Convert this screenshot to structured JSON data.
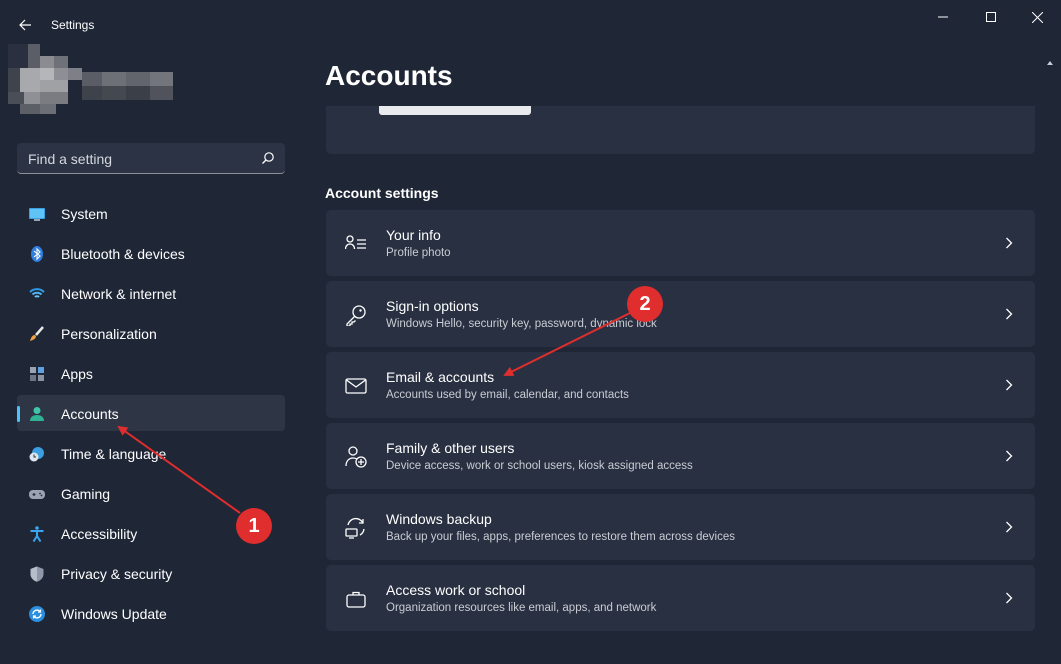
{
  "app": {
    "title": "Settings",
    "page_title": "Accounts"
  },
  "search": {
    "placeholder": "Find a setting"
  },
  "sidebar": {
    "items": [
      {
        "label": "System",
        "icon": "monitor-icon"
      },
      {
        "label": "Bluetooth & devices",
        "icon": "bluetooth-icon"
      },
      {
        "label": "Network & internet",
        "icon": "wifi-icon"
      },
      {
        "label": "Personalization",
        "icon": "brush-icon"
      },
      {
        "label": "Apps",
        "icon": "apps-icon"
      },
      {
        "label": "Accounts",
        "icon": "person-icon",
        "active": true
      },
      {
        "label": "Time & language",
        "icon": "clock-globe-icon"
      },
      {
        "label": "Gaming",
        "icon": "gamepad-icon"
      },
      {
        "label": "Accessibility",
        "icon": "accessibility-icon"
      },
      {
        "label": "Privacy & security",
        "icon": "shield-icon"
      },
      {
        "label": "Windows Update",
        "icon": "update-icon"
      }
    ]
  },
  "main": {
    "section_label": "Account settings",
    "cards": [
      {
        "title": "Your info",
        "subtitle": "Profile photo",
        "icon": "person-card-icon"
      },
      {
        "title": "Sign-in options",
        "subtitle": "Windows Hello, security key, password, dynamic lock",
        "icon": "key-icon"
      },
      {
        "title": "Email & accounts",
        "subtitle": "Accounts used by email, calendar, and contacts",
        "icon": "mail-icon"
      },
      {
        "title": "Family & other users",
        "subtitle": "Device access, work or school users, kiosk assigned access",
        "icon": "family-icon"
      },
      {
        "title": "Windows backup",
        "subtitle": "Back up your files, apps, preferences to restore them across devices",
        "icon": "backup-icon"
      },
      {
        "title": "Access work or school",
        "subtitle": "Organization resources like email, apps, and network",
        "icon": "briefcase-icon"
      }
    ]
  },
  "annotations": {
    "badge1": "1",
    "badge2": "2"
  },
  "colors": {
    "background": "#1f2636",
    "card": "#293041",
    "accent": "#4cc2ff",
    "annotation": "#e02d2d"
  }
}
